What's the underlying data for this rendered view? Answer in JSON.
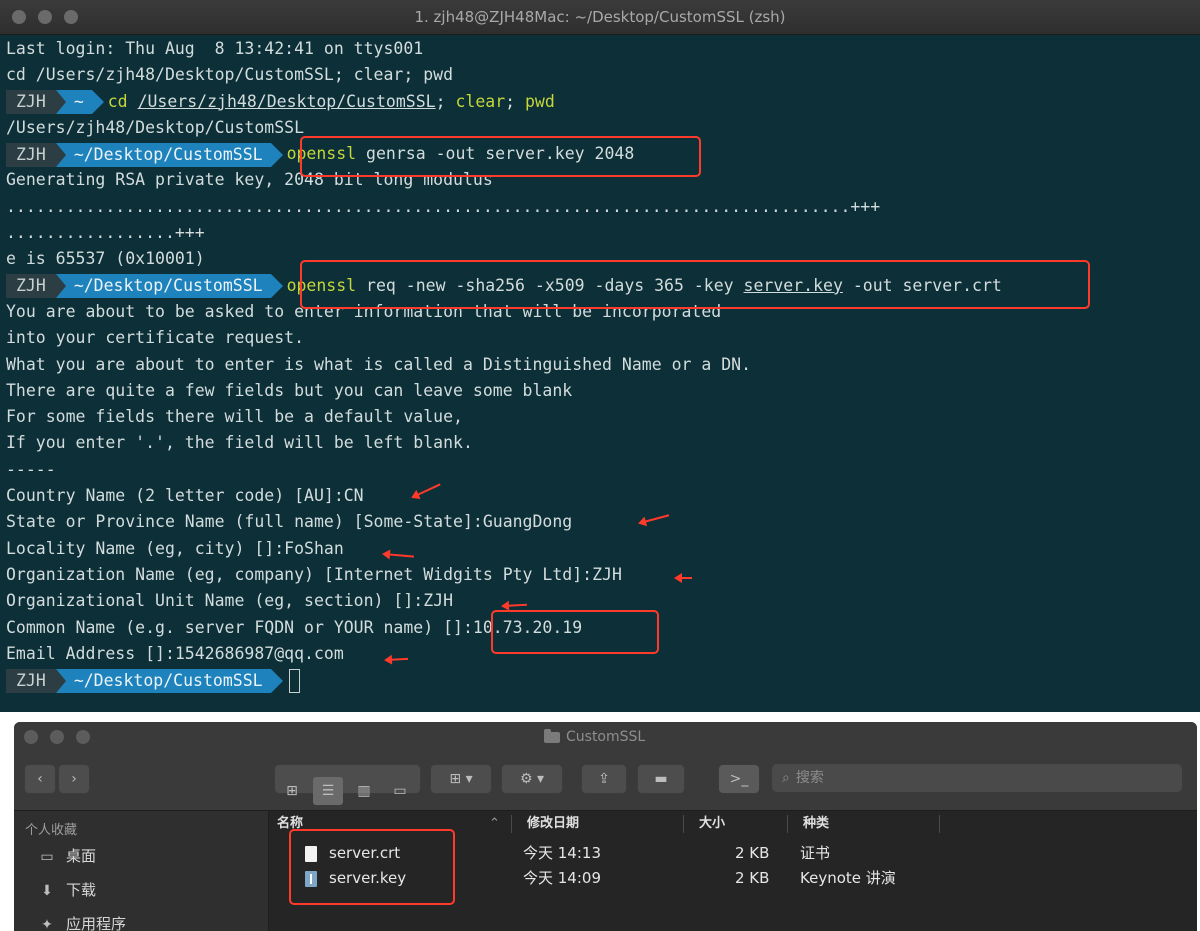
{
  "terminal": {
    "title": "1. zjh48@ZJH48Mac: ~/Desktop/CustomSSL (zsh)",
    "prompt_user": "ZJH",
    "lines": {
      "l1": "Last login: Thu Aug  8 13:42:41 on ttys001",
      "l2": "cd /Users/zjh48/Desktop/CustomSSL; clear; pwd",
      "p1_dir": "~",
      "p1_cd": "cd",
      "p1_path": "/Users/zjh48/Desktop/CustomSSL",
      "p1_semi1": ";",
      "p1_clear": "clear",
      "p1_semi2": ";",
      "p1_pwd": "pwd",
      "l4": "/Users/zjh48/Desktop/CustomSSL",
      "p2_dir": "~/Desktop/CustomSSL",
      "p2_cmd": "openssl",
      "p2_args": "genrsa -out server.key 2048",
      "l6": "Generating RSA private key, 2048 bit long modulus",
      "l7": ".....................................................................................+++",
      "l8": ".................+++",
      "l9": "e is 65537 (0x10001)",
      "p3_dir": "~/Desktop/CustomSSL",
      "p3_cmd": "openssl",
      "p3_args1": "req -new -sha256 -x509 -days 365 -key",
      "p3_key": "server.key",
      "p3_args2": "-out server.crt",
      "l11": "You are about to be asked to enter information that will be incorporated",
      "l12": "into your certificate request.",
      "l13": "What you are about to enter is what is called a Distinguished Name or a DN.",
      "l14": "There are quite a few fields but you can leave some blank",
      "l15": "For some fields there will be a default value,",
      "l16": "If you enter '.', the field will be left blank.",
      "l17": "-----",
      "l18": "Country Name (2 letter code) [AU]:CN",
      "l19": "State or Province Name (full name) [Some-State]:GuangDong",
      "l20": "Locality Name (eg, city) []:FoShan",
      "l21": "Organization Name (eg, company) [Internet Widgits Pty Ltd]:ZJH",
      "l22": "Organizational Unit Name (eg, section) []:ZJH",
      "l23": "Common Name (e.g. server FQDN or YOUR name) []:10.73.20.19",
      "l24": "Email Address []:1542686987@qq.com",
      "p4_dir": "~/Desktop/CustomSSL"
    }
  },
  "finder": {
    "title": "CustomSSL",
    "search_placeholder": "搜索",
    "sidebar": {
      "section": "个人收藏",
      "items": [
        "桌面",
        "下载",
        "应用程序"
      ]
    },
    "columns": {
      "name": "名称",
      "date": "修改日期",
      "size": "大小",
      "kind": "种类"
    },
    "files": [
      {
        "name": "server.crt",
        "date": "今天 14:13",
        "size": "2 KB",
        "kind": "证书"
      },
      {
        "name": "server.key",
        "date": "今天 14:09",
        "size": "2 KB",
        "kind": "Keynote 讲演"
      }
    ]
  },
  "colors": {
    "terminal_bg": "#0c2f38",
    "highlight": "#ff3a2a",
    "prompt_dir_bg": "#1e82bd",
    "command_name": "#c4d639"
  }
}
